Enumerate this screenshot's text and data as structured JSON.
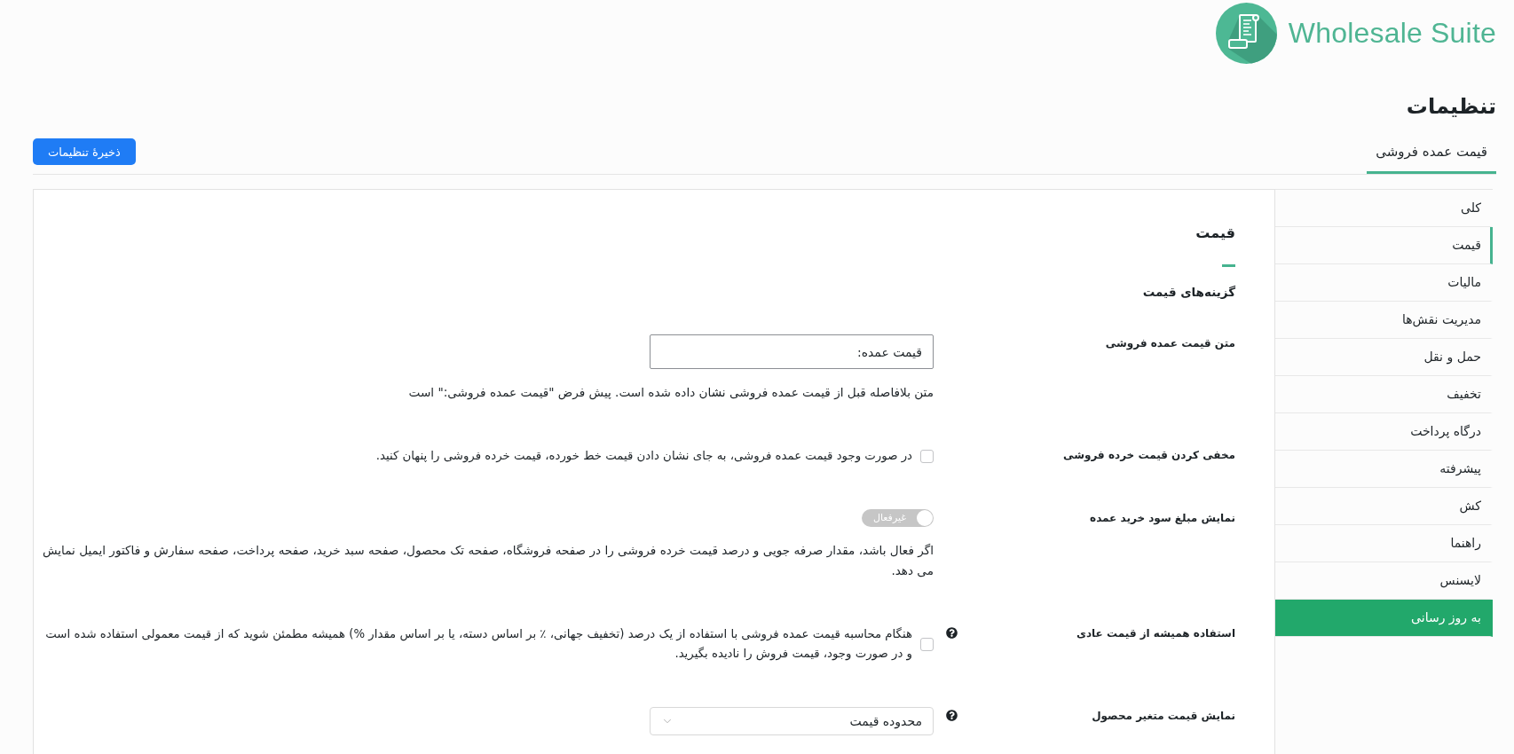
{
  "header": {
    "logo_text": "Wholesale Suite"
  },
  "page_title": "تنظیمات",
  "tabs": [
    {
      "label": "قیمت عمده فروشی",
      "selected": true
    }
  ],
  "save_button": {
    "label": "ذخیرهٔ تنظیمات"
  },
  "sidebar": {
    "items": [
      {
        "label": "کلی",
        "kind": "link",
        "selected": false
      },
      {
        "label": "قیمت",
        "kind": "link",
        "selected": true
      },
      {
        "label": "مالیات",
        "kind": "link",
        "selected": false
      },
      {
        "label": "مدیریت نقش‌ها",
        "kind": "link",
        "selected": false
      },
      {
        "label": "حمل و نقل",
        "kind": "link",
        "selected": false
      },
      {
        "label": "تخفیف",
        "kind": "link",
        "selected": false
      },
      {
        "label": "درگاه پرداخت",
        "kind": "link",
        "selected": false
      },
      {
        "label": "پیشرفته",
        "kind": "link",
        "selected": false
      },
      {
        "label": "کش",
        "kind": "link",
        "selected": false
      },
      {
        "label": "راهنما",
        "kind": "link",
        "selected": false
      },
      {
        "label": "لایسنس",
        "kind": "link",
        "selected": false
      },
      {
        "label": "به روز رسانی",
        "kind": "highlight",
        "selected": false
      }
    ]
  },
  "section": {
    "title": "قیمت",
    "subtitle": "گزینه‌های قیمت",
    "fields": [
      {
        "kind": "text",
        "label": "متن قیمت عمده فروشی",
        "help": false,
        "value": "قیمت عمده:",
        "description": "متن بلافاصله قبل از قیمت عمده فروشی نشان داده شده است. پیش فرض \"قیمت عمده فروشی:\" است"
      },
      {
        "kind": "checkbox",
        "label": "مخفی کردن قیمت خرده فروشی",
        "help": false,
        "checked": false,
        "description": "در صورت وجود قیمت عمده فروشی، به جای نشان دادن قیمت خط خورده، قیمت خرده فروشی را پنهان کنید."
      },
      {
        "kind": "toggle",
        "label": "نمایش مبلغ سود خرید عمده",
        "help": false,
        "on": false,
        "state_text": "غیرفعال",
        "description": "اگر فعال باشد، مقدار صرفه جویی و درصد قیمت خرده فروشی را در صفحه فروشگاه، صفحه تک محصول، صفحه سبد خرید، صفحه پرداخت، صفحه سفارش و فاکتور ایمیل نمایش می دهد."
      },
      {
        "kind": "checkbox",
        "label": "استفاده همیشه از قیمت عادی",
        "help": true,
        "checked": false,
        "description": "هنگام محاسبه قیمت عمده فروشی با استفاده از یک درصد (تخفیف جهانی، ٪ بر اساس دسته، یا بر اساس مقدار %) همیشه مطمئن شوید که از قیمت معمولی استفاده شده است و در صورت وجود، قیمت فروش را نادیده بگیرید."
      },
      {
        "kind": "select",
        "label": "نمایش قیمت متغیر محصول",
        "help": true,
        "value": "محدوده قیمت"
      }
    ]
  }
}
